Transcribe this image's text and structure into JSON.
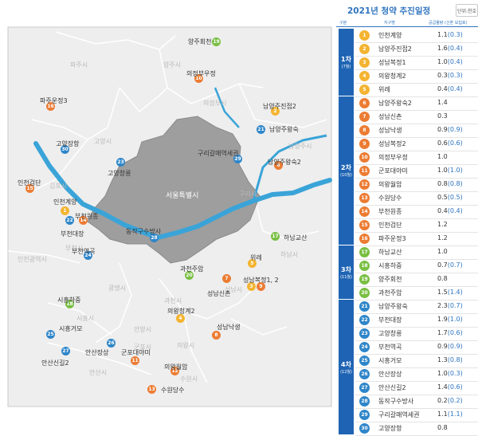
{
  "title": "2021년 청약 추진일정",
  "unit_button": "단위:천호",
  "headers": {
    "col1": "구분",
    "col2": "지구명",
    "col3": "공급물량 (신혼 모집호)"
  },
  "groups": [
    {
      "name": "1차",
      "count": "(7월)",
      "first": 1,
      "rows": 5,
      "color": "#f4b431"
    },
    {
      "name": "2차",
      "count": "(10월)",
      "first": 6,
      "rows": 11,
      "color": "#ec7c33"
    },
    {
      "name": "3차",
      "count": "(11월)",
      "first": 17,
      "rows": 4,
      "color": "#79bf43"
    },
    {
      "name": "4차",
      "count": "(12월)",
      "first": 21,
      "rows": 10,
      "color": "#2f86c9"
    }
  ],
  "rows": [
    {
      "num": "1",
      "name": "인천계양",
      "val": "1.1",
      "sub": "(0.3)"
    },
    {
      "num": "2",
      "name": "남양주진접2",
      "val": "1.6",
      "sub": "(0.4)"
    },
    {
      "num": "3",
      "name": "성남복정1",
      "val": "1.0",
      "sub": "(0.4)"
    },
    {
      "num": "4",
      "name": "의왕청계2",
      "val": "0.3",
      "sub": "(0.3)"
    },
    {
      "num": "5",
      "name": "위례",
      "val": "0.4",
      "sub": "(0.4)"
    },
    {
      "num": "6",
      "name": "남양주왕숙2",
      "val": "1.4",
      "sub": ""
    },
    {
      "num": "7",
      "name": "성남신촌",
      "val": "0.3",
      "sub": ""
    },
    {
      "num": "8",
      "name": "성남낙생",
      "val": "0.9",
      "sub": "(0.9)"
    },
    {
      "num": "9",
      "name": "성남복정2",
      "val": "0.6",
      "sub": "(0.6)"
    },
    {
      "num": "10",
      "name": "의정부우정",
      "val": "1.0",
      "sub": ""
    },
    {
      "num": "11",
      "name": "군포대야미",
      "val": "1.0",
      "sub": "(1.0)"
    },
    {
      "num": "12",
      "name": "의왕월암",
      "val": "0.8",
      "sub": "(0.8)"
    },
    {
      "num": "13",
      "name": "수원당수",
      "val": "0.5",
      "sub": "(0.5)"
    },
    {
      "num": "14",
      "name": "부천원종",
      "val": "0.4",
      "sub": "(0.4)"
    },
    {
      "num": "15",
      "name": "인천검단",
      "val": "1.2",
      "sub": ""
    },
    {
      "num": "16",
      "name": "파주운정3",
      "val": "1.2",
      "sub": ""
    },
    {
      "num": "17",
      "name": "하남교산",
      "val": "1.0",
      "sub": ""
    },
    {
      "num": "18",
      "name": "시흥하중",
      "val": "0.7",
      "sub": "(0.7)"
    },
    {
      "num": "19",
      "name": "양주회천",
      "val": "0.8",
      "sub": ""
    },
    {
      "num": "20",
      "name": "과천주암",
      "val": "1.5",
      "sub": "(1.4)"
    },
    {
      "num": "21",
      "name": "남양주왕숙",
      "val": "2.3",
      "sub": "(0.7)"
    },
    {
      "num": "22",
      "name": "부천대장",
      "val": "1.9",
      "sub": "(1.0)"
    },
    {
      "num": "23",
      "name": "고양창릉",
      "val": "1.7",
      "sub": "(0.6)"
    },
    {
      "num": "24",
      "name": "부천역곡",
      "val": "0.9",
      "sub": "(0.9)"
    },
    {
      "num": "25",
      "name": "시흥거모",
      "val": "1.3",
      "sub": "(0.8)"
    },
    {
      "num": "26",
      "name": "안산장상",
      "val": "1.0",
      "sub": "(0.3)"
    },
    {
      "num": "27",
      "name": "안산신길2",
      "val": "1.4",
      "sub": "(0.6)"
    },
    {
      "num": "28",
      "name": "동작구수방사",
      "val": "0.2",
      "sub": "(0.2)"
    },
    {
      "num": "29",
      "name": "구리갈매역세권",
      "val": "1.1",
      "sub": "(1.1)"
    },
    {
      "num": "30",
      "name": "고양장항",
      "val": "0.8",
      "sub": ""
    }
  ],
  "map": {
    "regions": [
      {
        "key": "paju",
        "text": "파주시"
      },
      {
        "key": "yangju",
        "text": "양주시"
      },
      {
        "key": "uijeongbu",
        "text": "의정부시"
      },
      {
        "key": "goyang",
        "text": "고양시"
      },
      {
        "key": "seoul",
        "text": "서울특별시"
      },
      {
        "key": "namyangju",
        "text": "남양주시"
      },
      {
        "key": "guri",
        "text": "구리시"
      },
      {
        "key": "gimpo",
        "text": "김포시"
      },
      {
        "key": "bucheon",
        "text": "부천시"
      },
      {
        "key": "incheon",
        "text": "인천광역시"
      },
      {
        "key": "hanam",
        "text": "하남시"
      },
      {
        "key": "gwangmyeong",
        "text": "광명시"
      },
      {
        "key": "gwacheon",
        "text": "과천시"
      },
      {
        "key": "seongnam",
        "text": "성남시"
      },
      {
        "key": "siheung",
        "text": "시흥시"
      },
      {
        "key": "anyang",
        "text": "안양시"
      },
      {
        "key": "uiwang",
        "text": "의왕시"
      },
      {
        "key": "ansan",
        "text": "안산시"
      },
      {
        "key": "gunpo",
        "text": "군포시"
      },
      {
        "key": "suwon",
        "text": "수원시"
      }
    ],
    "markers": [
      {
        "num": "19",
        "label": "양주회천"
      },
      {
        "num": "10",
        "label": "의정부우정"
      },
      {
        "num": "2",
        "label": "남양주진접2"
      },
      {
        "num": "16",
        "label": "파주운정3"
      },
      {
        "num": "21",
        "label": "남양주왕숙"
      },
      {
        "num": "29",
        "label": "구리갈매역세권"
      },
      {
        "num": "30",
        "label": "고양장항"
      },
      {
        "num": "23",
        "label": "고양창릉"
      },
      {
        "num": "6",
        "label": "남양주왕숙2"
      },
      {
        "num": "15",
        "label": "인천검단"
      },
      {
        "num": "1",
        "label": "인천계양"
      },
      {
        "num": "14",
        "label": "부천원종"
      },
      {
        "num": "22",
        "label": "부천대장"
      },
      {
        "num": "28",
        "label": "동작구수방사"
      },
      {
        "num": "17",
        "label": "하남교산"
      },
      {
        "num": "24",
        "label": "부천역곡"
      },
      {
        "num": "5",
        "label": "위례"
      },
      {
        "num": "20",
        "label": "과천주암"
      },
      {
        "num": "7",
        "label": "성남신촌"
      },
      {
        "num": "3",
        "label": "성남복정1, 2"
      },
      {
        "num": "9",
        "label": ""
      },
      {
        "num": "18",
        "label": "시흥하중"
      },
      {
        "num": "4",
        "label": "의왕청계2"
      },
      {
        "num": "8",
        "label": "성남낙생"
      },
      {
        "num": "25",
        "label": "시흥거모"
      },
      {
        "num": "26",
        "label": "안산장상"
      },
      {
        "num": "27",
        "label": "안산신길2"
      },
      {
        "num": "11",
        "label": "군포대야미"
      },
      {
        "num": "12",
        "label": "의왕월암"
      },
      {
        "num": "13",
        "label": "수원당수"
      }
    ]
  }
}
